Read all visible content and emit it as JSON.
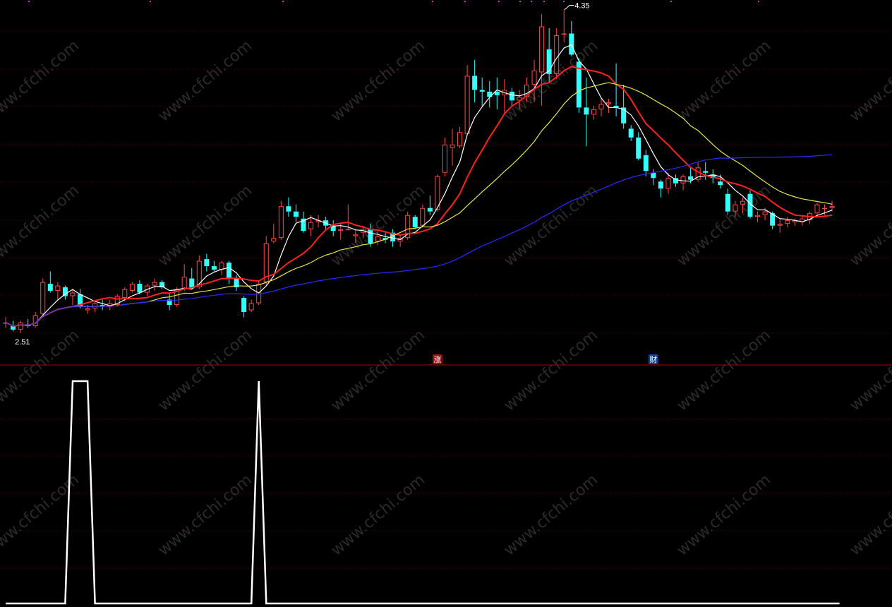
{
  "watermark": "www.cfchi.com",
  "colors": {
    "background": "#000000",
    "up": "#ff4a4a",
    "down": "#33ffff",
    "grid": "#5a0000",
    "divider": "#b00000",
    "ma5": "#ffffff",
    "ma10": "#ff2222",
    "ma20": "#e6e64a",
    "ma60": "#2a2aff",
    "indicator": "#ffffff",
    "badge_up": "#8a1010",
    "badge_down": "#103f8a"
  },
  "price_labels": {
    "high": "4.35",
    "low": "2.51"
  },
  "badges": [
    {
      "name": "badge-zhang",
      "text": "涨",
      "index": 58,
      "kind": "up"
    },
    {
      "name": "badge-cai",
      "text": "财",
      "index": 87,
      "kind": "down"
    }
  ],
  "chart_data": [
    {
      "type": "candlestick",
      "title": "",
      "xlabel": "",
      "ylabel": "",
      "ylim": [
        2.47,
        4.38
      ],
      "grid": true,
      "ohlc": [
        [
          2.57,
          2.6,
          2.54,
          2.57
        ],
        [
          2.55,
          2.58,
          2.52,
          2.53
        ],
        [
          2.53,
          2.58,
          2.51,
          2.57
        ],
        [
          2.56,
          2.59,
          2.54,
          2.55
        ],
        [
          2.55,
          2.63,
          2.54,
          2.61
        ],
        [
          2.62,
          2.82,
          2.61,
          2.8
        ],
        [
          2.79,
          2.86,
          2.74,
          2.75
        ],
        [
          2.75,
          2.8,
          2.7,
          2.78
        ],
        [
          2.77,
          2.78,
          2.7,
          2.72
        ],
        [
          2.72,
          2.76,
          2.67,
          2.74
        ],
        [
          2.73,
          2.76,
          2.65,
          2.66
        ],
        [
          2.64,
          2.67,
          2.62,
          2.65
        ],
        [
          2.65,
          2.69,
          2.63,
          2.68
        ],
        [
          2.67,
          2.7,
          2.64,
          2.66
        ],
        [
          2.66,
          2.7,
          2.64,
          2.68
        ],
        [
          2.67,
          2.73,
          2.66,
          2.72
        ],
        [
          2.71,
          2.77,
          2.69,
          2.76
        ],
        [
          2.75,
          2.8,
          2.74,
          2.79
        ],
        [
          2.79,
          2.81,
          2.73,
          2.74
        ],
        [
          2.74,
          2.79,
          2.72,
          2.78
        ],
        [
          2.78,
          2.82,
          2.75,
          2.8
        ],
        [
          2.8,
          2.81,
          2.76,
          2.77
        ],
        [
          2.7,
          2.74,
          2.64,
          2.67
        ],
        [
          2.67,
          2.77,
          2.66,
          2.76
        ],
        [
          2.76,
          2.9,
          2.75,
          2.83
        ],
        [
          2.82,
          2.88,
          2.76,
          2.77
        ],
        [
          2.77,
          2.95,
          2.76,
          2.92
        ],
        [
          2.93,
          2.96,
          2.86,
          2.89
        ],
        [
          2.89,
          2.92,
          2.86,
          2.87
        ],
        [
          2.87,
          2.92,
          2.84,
          2.91
        ],
        [
          2.91,
          2.92,
          2.79,
          2.82
        ],
        [
          2.82,
          2.84,
          2.75,
          2.77
        ],
        [
          2.71,
          2.72,
          2.6,
          2.63
        ],
        [
          2.64,
          2.7,
          2.63,
          2.68
        ],
        [
          2.68,
          2.81,
          2.67,
          2.79
        ],
        [
          2.8,
          3.06,
          2.78,
          3.02
        ],
        [
          3.03,
          3.13,
          3.02,
          3.05
        ],
        [
          3.05,
          3.26,
          3.04,
          3.23
        ],
        [
          3.23,
          3.28,
          3.17,
          3.2
        ],
        [
          3.2,
          3.24,
          3.14,
          3.17
        ],
        [
          3.16,
          3.2,
          3.08,
          3.09
        ],
        [
          3.1,
          3.18,
          3.06,
          3.14
        ],
        [
          3.14,
          3.18,
          3.11,
          3.15
        ],
        [
          3.15,
          3.17,
          3.1,
          3.12
        ],
        [
          3.12,
          3.15,
          3.06,
          3.09
        ],
        [
          3.09,
          3.13,
          3.04,
          3.1
        ],
        [
          3.1,
          3.24,
          3.1,
          3.1
        ],
        [
          3.06,
          3.1,
          3.02,
          3.07
        ],
        [
          3.08,
          3.12,
          3.05,
          3.1
        ],
        [
          3.1,
          3.13,
          3.0,
          3.02
        ],
        [
          3.03,
          3.09,
          3.01,
          3.06
        ],
        [
          3.05,
          3.08,
          3.02,
          3.04
        ],
        [
          3.08,
          3.1,
          3.0,
          3.03
        ],
        [
          3.03,
          3.07,
          3.0,
          3.05
        ],
        [
          3.05,
          3.2,
          3.04,
          3.18
        ],
        [
          3.17,
          3.18,
          3.1,
          3.11
        ],
        [
          3.12,
          3.24,
          3.11,
          3.22
        ],
        [
          3.22,
          3.29,
          3.18,
          3.2
        ],
        [
          3.21,
          3.41,
          3.2,
          3.4
        ],
        [
          3.42,
          3.62,
          3.4,
          3.58
        ],
        [
          3.56,
          3.67,
          3.46,
          3.58
        ],
        [
          3.57,
          3.68,
          3.56,
          3.65
        ],
        [
          3.64,
          4.03,
          3.63,
          3.97
        ],
        [
          3.97,
          4.06,
          3.82,
          3.89
        ],
        [
          3.89,
          3.96,
          3.8,
          3.88
        ],
        [
          3.88,
          3.94,
          3.79,
          3.85
        ],
        [
          3.88,
          3.96,
          3.78,
          3.86
        ],
        [
          3.86,
          3.95,
          3.76,
          3.89
        ],
        [
          3.88,
          3.9,
          3.8,
          3.83
        ],
        [
          3.83,
          3.89,
          3.78,
          3.85
        ],
        [
          3.85,
          3.96,
          3.82,
          3.92
        ],
        [
          3.92,
          4.06,
          3.82,
          4.0
        ],
        [
          3.99,
          4.32,
          3.8,
          4.25
        ],
        [
          4.12,
          4.24,
          3.93,
          3.98
        ],
        [
          3.98,
          4.24,
          3.95,
          4.2
        ],
        [
          4.21,
          4.35,
          4.16,
          4.21
        ],
        [
          4.21,
          4.28,
          4.08,
          4.09
        ],
        [
          4.05,
          4.07,
          3.76,
          3.79
        ],
        [
          3.79,
          3.96,
          3.57,
          3.75
        ],
        [
          3.75,
          3.8,
          3.72,
          3.78
        ],
        [
          3.78,
          3.84,
          3.74,
          3.81
        ],
        [
          3.81,
          3.84,
          3.76,
          3.82
        ],
        [
          3.8,
          4.04,
          3.74,
          3.79
        ],
        [
          3.79,
          3.92,
          3.67,
          3.7
        ],
        [
          3.67,
          3.69,
          3.6,
          3.62
        ],
        [
          3.62,
          3.65,
          3.49,
          3.5
        ],
        [
          3.52,
          3.55,
          3.4,
          3.43
        ],
        [
          3.42,
          3.44,
          3.35,
          3.39
        ],
        [
          3.37,
          3.38,
          3.28,
          3.33
        ],
        [
          3.33,
          3.42,
          3.3,
          3.39
        ],
        [
          3.39,
          3.41,
          3.34,
          3.36
        ],
        [
          3.36,
          3.41,
          3.32,
          3.4
        ],
        [
          3.4,
          3.45,
          3.36,
          3.38
        ],
        [
          3.38,
          3.48,
          3.37,
          3.45
        ],
        [
          3.43,
          3.48,
          3.38,
          3.42
        ],
        [
          3.41,
          3.44,
          3.36,
          3.39
        ],
        [
          3.37,
          3.41,
          3.33,
          3.35
        ],
        [
          3.3,
          3.33,
          3.18,
          3.2
        ],
        [
          3.2,
          3.26,
          3.17,
          3.24
        ],
        [
          3.24,
          3.28,
          3.19,
          3.26
        ],
        [
          3.3,
          3.32,
          3.16,
          3.17
        ],
        [
          3.17,
          3.2,
          3.14,
          3.18
        ],
        [
          3.18,
          3.22,
          3.15,
          3.2
        ],
        [
          3.19,
          3.2,
          3.1,
          3.12
        ],
        [
          3.12,
          3.16,
          3.08,
          3.13
        ],
        [
          3.13,
          3.17,
          3.11,
          3.15
        ],
        [
          3.14,
          3.16,
          3.12,
          3.15
        ],
        [
          3.14,
          3.18,
          3.12,
          3.16
        ],
        [
          3.15,
          3.2,
          3.13,
          3.19
        ],
        [
          3.19,
          3.25,
          3.18,
          3.24
        ],
        [
          3.22,
          3.24,
          3.18,
          3.22
        ],
        [
          3.22,
          3.26,
          3.2,
          3.23
        ]
      ],
      "moving_averages": [
        {
          "period": 5,
          "color_key": "ma5"
        },
        {
          "period": 10,
          "color_key": "ma10"
        },
        {
          "period": 20,
          "color_key": "ma20"
        },
        {
          "period": 60,
          "color_key": "ma60"
        }
      ]
    },
    {
      "type": "line",
      "title": "",
      "xlabel": "",
      "ylabel": "",
      "ylim": [
        0,
        1
      ],
      "grid": true,
      "series": [
        {
          "values": [
            0,
            0,
            0,
            0,
            0,
            0,
            0,
            0,
            0,
            1,
            1,
            1,
            0,
            0,
            0,
            0,
            0,
            0,
            0,
            0,
            0,
            0,
            0,
            0,
            0,
            0,
            0,
            0,
            0,
            0,
            0,
            0,
            0,
            0,
            1,
            0,
            0,
            0,
            0,
            0,
            0,
            0,
            0,
            0,
            0,
            0,
            0,
            0,
            0,
            0,
            0,
            0,
            0,
            0,
            0,
            0,
            0,
            0,
            0,
            0,
            0,
            0,
            0,
            0,
            0,
            0,
            0,
            0,
            0,
            0,
            0,
            0,
            0,
            0,
            0,
            0,
            0,
            0,
            0,
            0,
            0,
            0,
            0,
            0,
            0,
            0,
            0,
            0,
            0,
            0,
            0,
            0,
            0,
            0,
            0,
            0,
            0,
            0,
            0,
            0,
            0,
            0,
            0,
            0,
            0,
            0,
            0,
            0,
            0,
            0,
            0,
            0,
            0
          ]
        }
      ]
    }
  ]
}
